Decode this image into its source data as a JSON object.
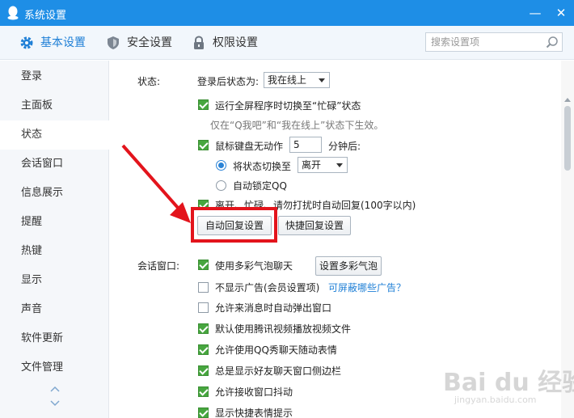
{
  "window": {
    "title": "系统设置",
    "minimize": "—",
    "close": "✕"
  },
  "tabs": [
    {
      "label": "基本设置",
      "icon": "gear-icon",
      "active": true
    },
    {
      "label": "安全设置",
      "icon": "shield-icon",
      "active": false
    },
    {
      "label": "权限设置",
      "icon": "lock-icon",
      "active": false
    }
  ],
  "search": {
    "placeholder": "搜索设置项",
    "value": ""
  },
  "sidebar": {
    "items": [
      {
        "label": "登录"
      },
      {
        "label": "主面板"
      },
      {
        "label": "状态",
        "active": true
      },
      {
        "label": "会话窗口"
      },
      {
        "label": "信息展示"
      },
      {
        "label": "提醒"
      },
      {
        "label": "热键"
      },
      {
        "label": "显示"
      },
      {
        "label": "声音"
      },
      {
        "label": "软件更新"
      },
      {
        "label": "文件管理"
      }
    ]
  },
  "status": {
    "section_label": "状态:",
    "login_status_label": "登录后状态为:",
    "login_status_value": "我在线上",
    "fullscreen_busy": {
      "label": "运行全屏程序时切换至“忙碌”状态",
      "checked": true
    },
    "fullscreen_note": "仅在“Q我吧”和“我在线上”状态下生效。",
    "idle": {
      "label": "鼠标键盘无动作",
      "checked": true,
      "minutes": "5",
      "suffix": "分钟后:"
    },
    "switch_status": {
      "label": "将状态切换至",
      "selected": true,
      "value": "离开"
    },
    "auto_lock": {
      "label": "自动锁定QQ",
      "selected": false
    },
    "auto_reply": {
      "label": "离开、忙碌、请勿打扰时自动回复(100字以内)",
      "checked": true
    },
    "auto_reply_button": "自动回复设置",
    "quick_reply_button": "快捷回复设置"
  },
  "chat": {
    "section_label": "会话窗口:",
    "bubble": {
      "label": "使用多彩气泡聊天",
      "checked": true,
      "button": "设置多彩气泡"
    },
    "no_ads": {
      "label": "不显示广告(会员设置项)",
      "checked": false,
      "link": "可屏蔽哪些广告？"
    },
    "auto_popup": {
      "label": "允许来消息时自动弹出窗口",
      "checked": false
    },
    "tencent_video": {
      "label": "默认使用腾讯视频播放视频文件",
      "checked": true
    },
    "qq_show": {
      "label": "允许使用QQ秀聊天随动表情",
      "checked": true
    },
    "sidebar_always": {
      "label": "总是显示好友聊天窗口侧边栏",
      "checked": true
    },
    "shake": {
      "label": "允许接收窗口抖动",
      "checked": true
    },
    "partial": {
      "label": "显示快捷表情提示",
      "checked": true
    }
  },
  "watermark": {
    "big": "Bai du 经验",
    "small": "jingyan.baidu.com"
  },
  "colors": {
    "titlebar": "#1e8ee6",
    "accent": "#1e7fd6",
    "checkbox": "#47a63f",
    "annotation": "#e3141c"
  }
}
